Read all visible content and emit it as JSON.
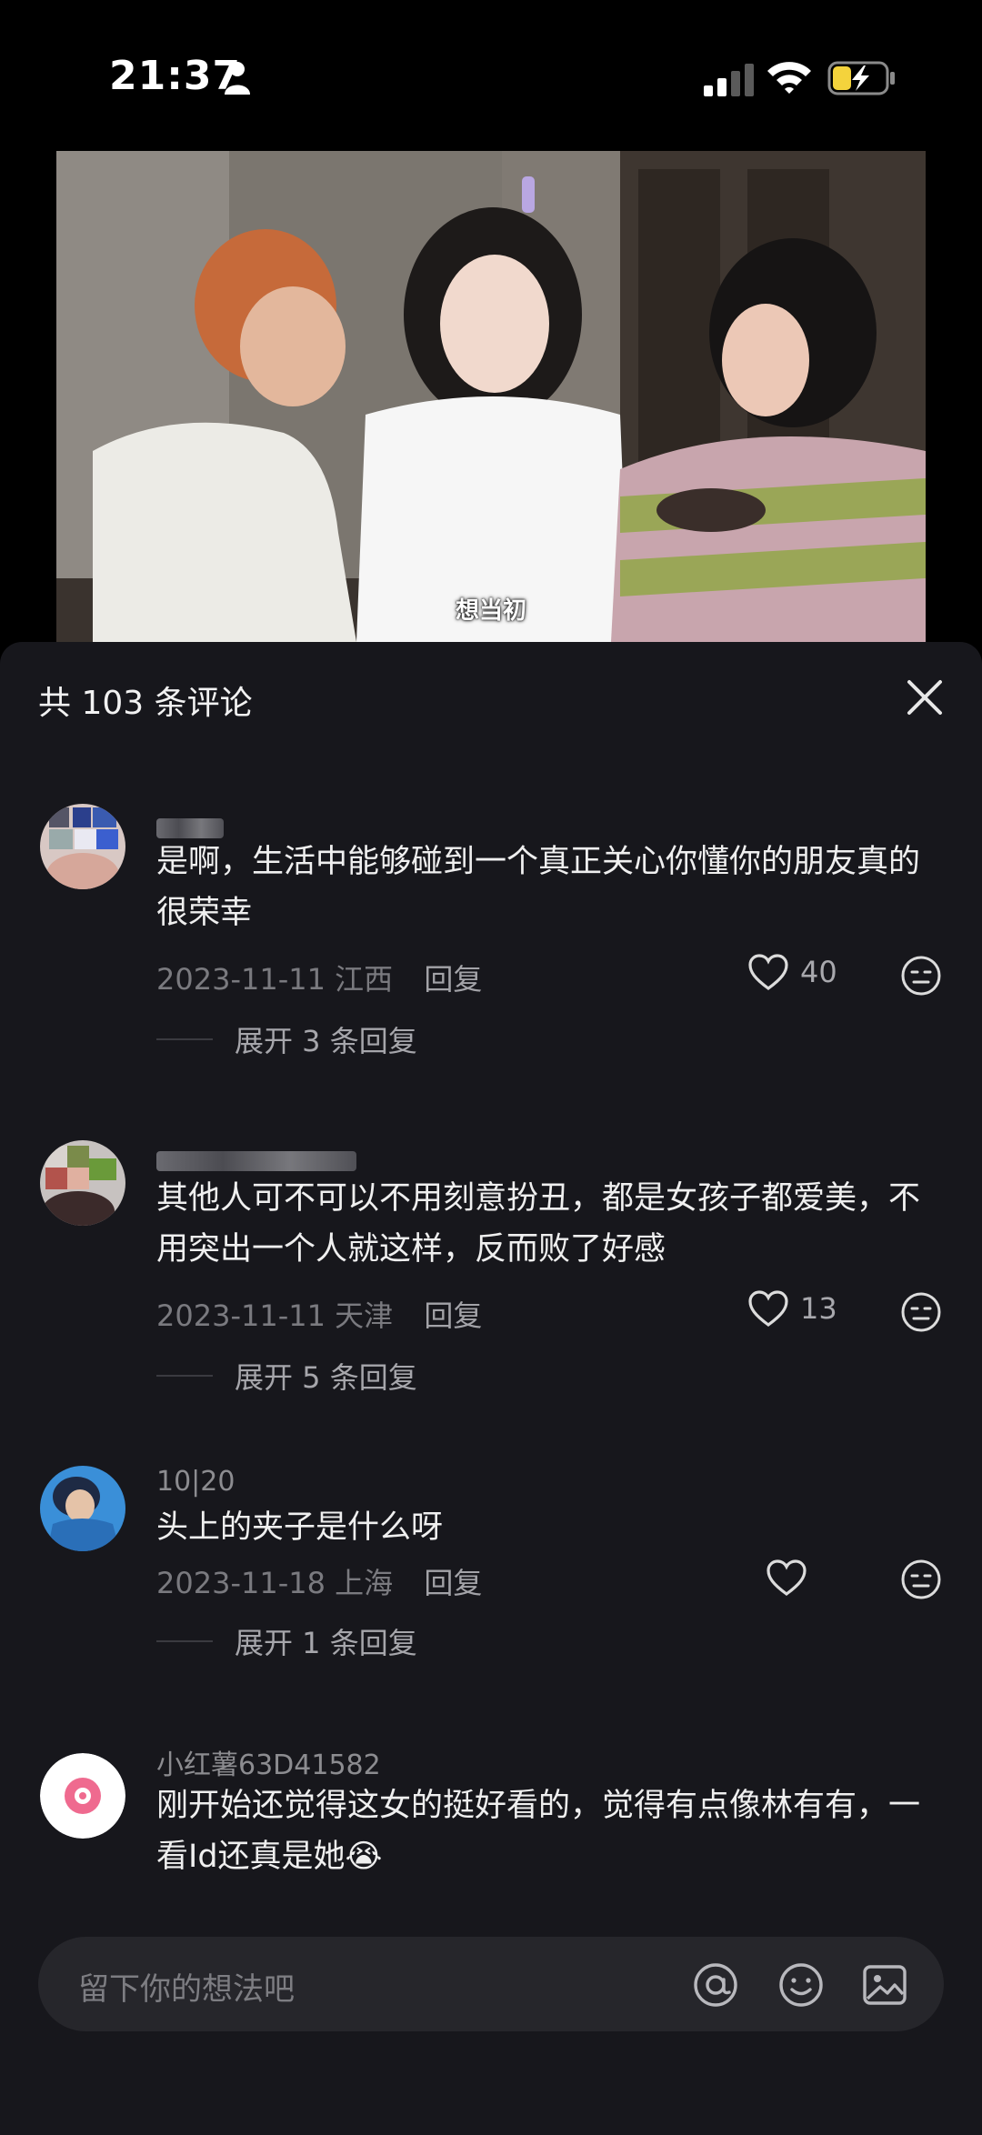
{
  "status_bar": {
    "time": "21:37"
  },
  "video": {
    "subtitle": "想当初"
  },
  "sheet": {
    "title": "共 103 条评论"
  },
  "comments": [
    {
      "text": "是啊，生活中能够碰到一个真正关心你懂你的朋友真的很荣幸",
      "date": "2023-11-11",
      "location": "江西",
      "reply_label": "回复",
      "likes": "40",
      "expand": "展开 3 条回复"
    },
    {
      "text": "其他人可不可以不用刻意扮丑，都是女孩子都爱美，不用突出一个人就这样，反而败了好感",
      "date": "2023-11-11",
      "location": "天津",
      "reply_label": "回复",
      "likes": "13",
      "expand": "展开 5 条回复"
    },
    {
      "username": "10|20",
      "text": "头上的夹子是什么呀",
      "date": "2023-11-18",
      "location": "上海",
      "reply_label": "回复",
      "likes": "",
      "expand": "展开 1 条回复"
    },
    {
      "username": "小红薯63D41582",
      "text": "刚开始还觉得这女的挺好看的，觉得有点像林有有，一看Id还真是她😭"
    }
  ],
  "input_bar": {
    "placeholder": "留下你的想法吧"
  },
  "icons": {
    "close": "close-icon",
    "like": "heart-icon",
    "dislike": "meh-face-icon",
    "mention": "at-icon",
    "emoji": "smile-icon",
    "image": "image-icon"
  },
  "colors": {
    "sheet_background": "#17171c",
    "input_background": "#26262b",
    "secondary_text": "#7a7a7f"
  }
}
